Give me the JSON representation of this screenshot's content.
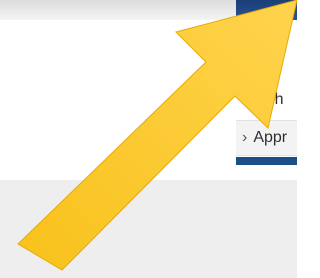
{
  "menu": {
    "items": [
      {
        "label": "Sch"
      },
      {
        "label": "Appr",
        "chevron": "›"
      }
    ]
  },
  "overlay": {
    "icon": "arrow-icon",
    "color": "#f8c21b"
  },
  "colors": {
    "accent": "#1b4f86",
    "highlight": "#f8c21b"
  }
}
